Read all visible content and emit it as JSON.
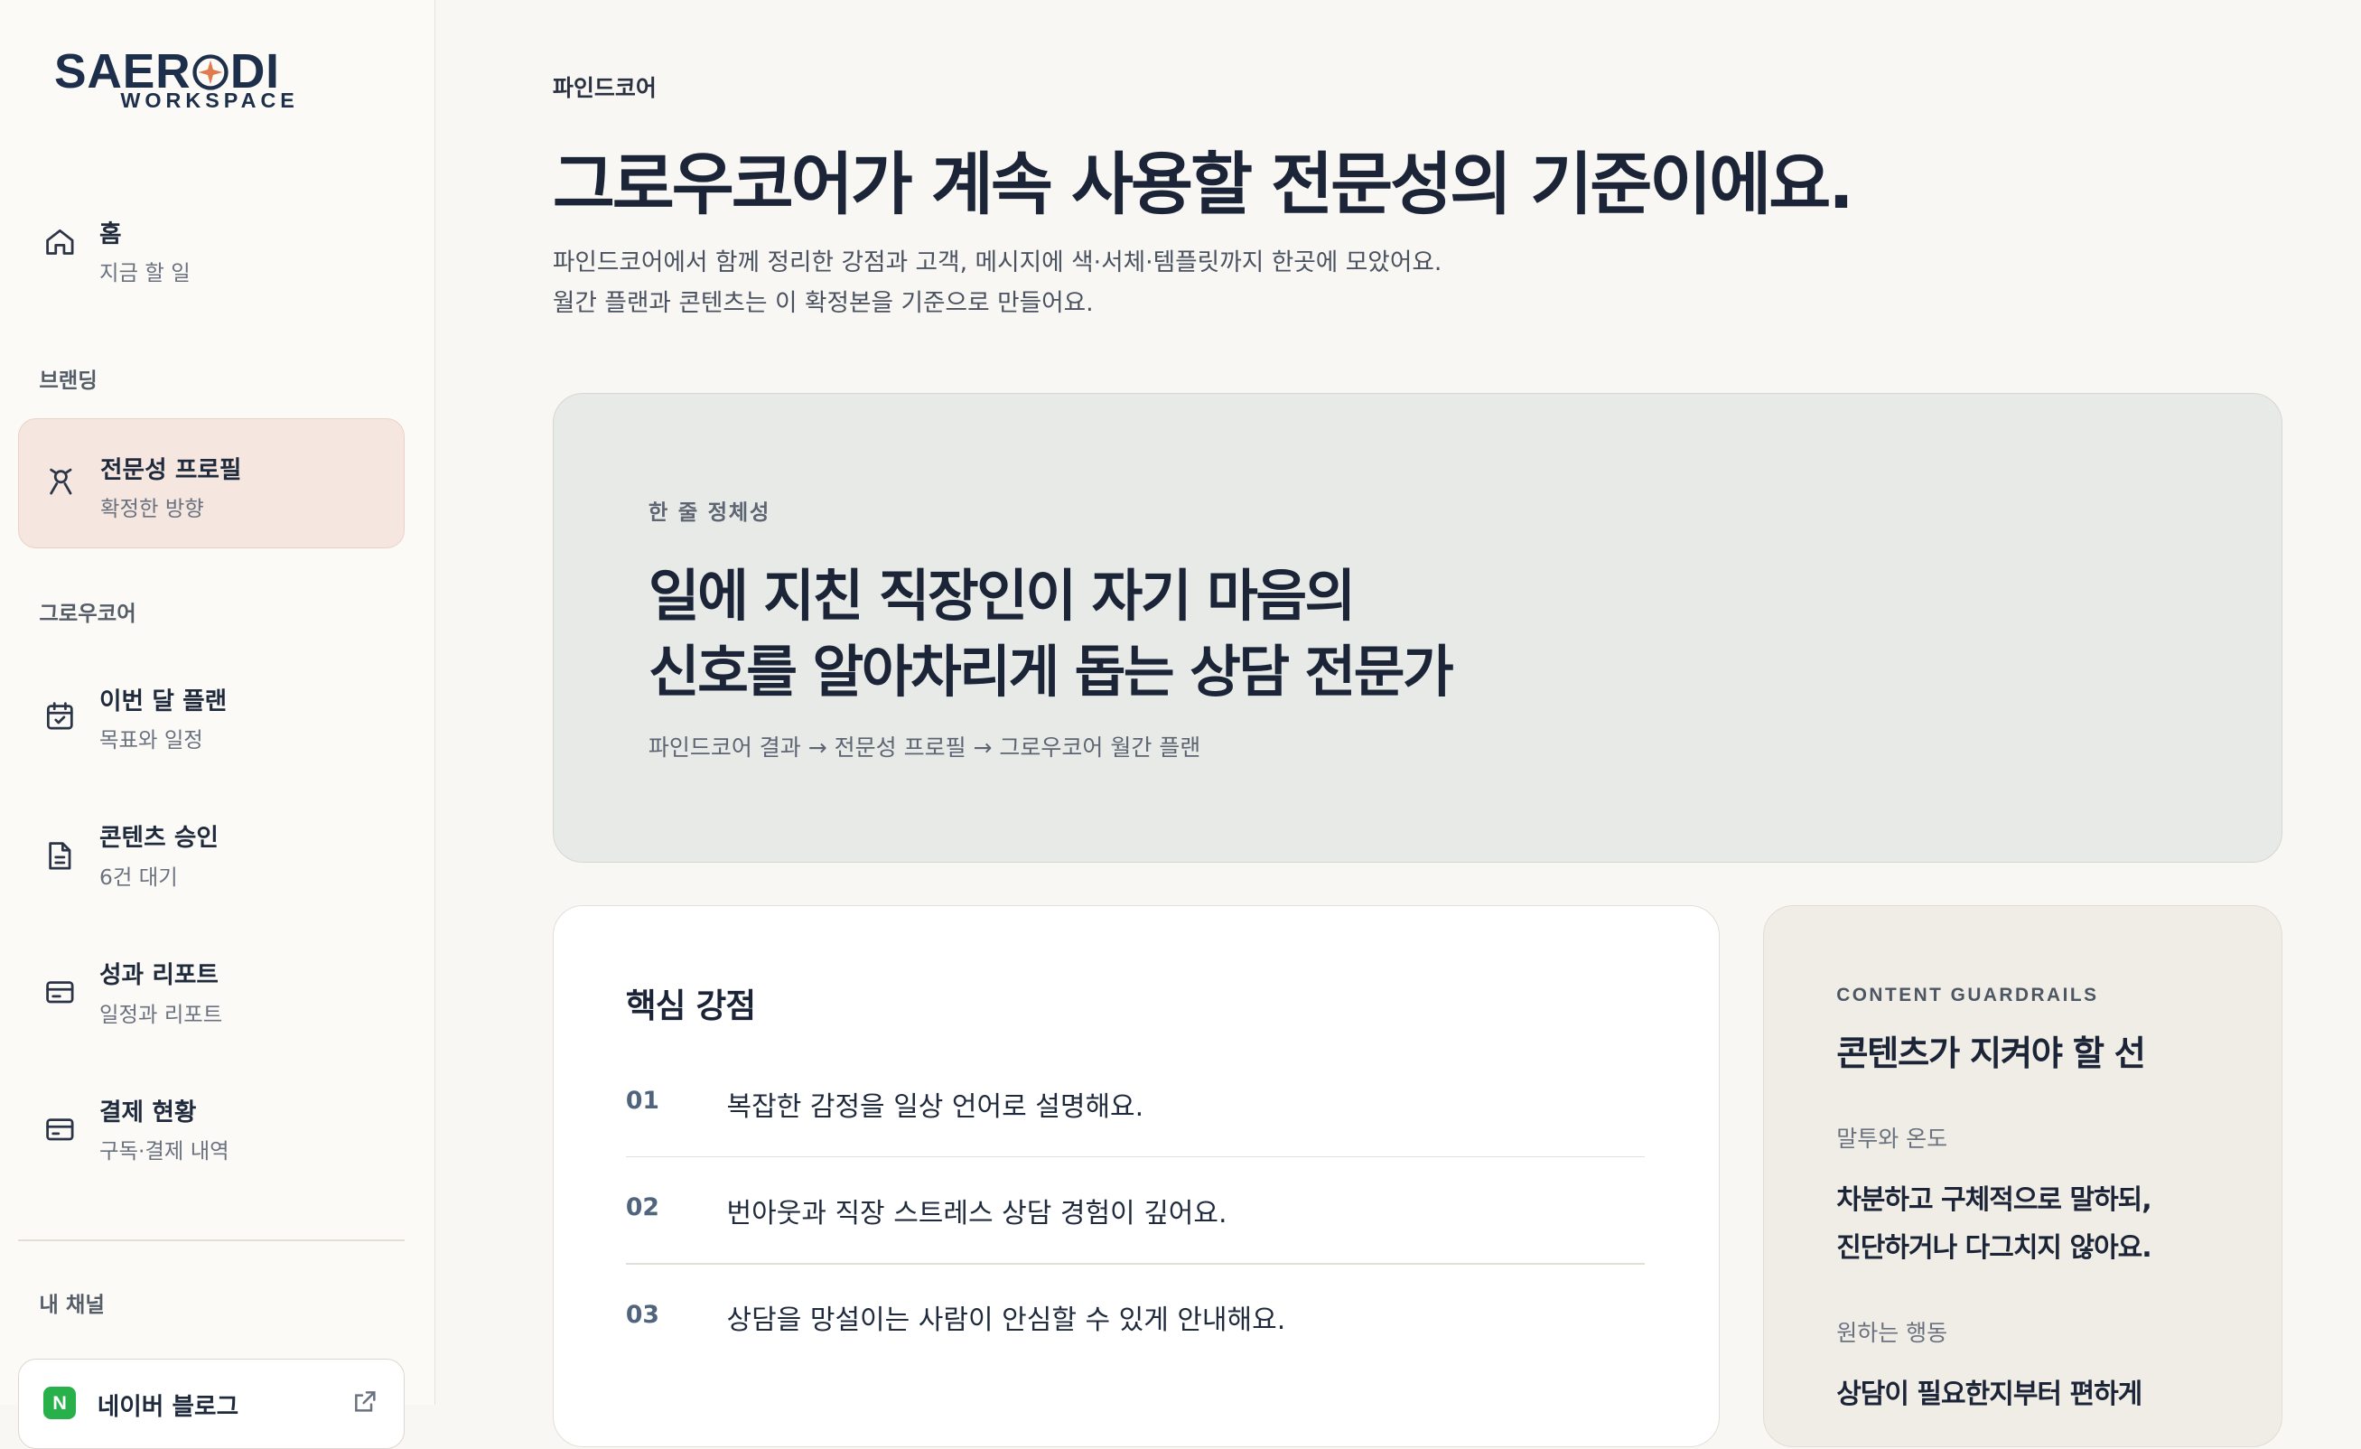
{
  "brand": {
    "name_left": "SAER",
    "name_right": "DI",
    "sub": "WORKSPACE",
    "accent": "#e07a50"
  },
  "sidebar": {
    "home": {
      "title": "홈",
      "sub": "지금 할 일",
      "icon": "home-icon"
    },
    "section_branding": "브랜딩",
    "profile": {
      "title": "전문성 프로필",
      "sub": "확정한 방향",
      "icon": "person-icon"
    },
    "section_growcore": "그로우코어",
    "items": [
      {
        "title": "이번 달 플랜",
        "sub": "목표와 일정",
        "icon": "calendar-check-icon"
      },
      {
        "title": "콘텐츠 승인",
        "sub": "6건 대기",
        "icon": "document-icon"
      },
      {
        "title": "성과 리포트",
        "sub": "일정과 리포트",
        "icon": "report-card-icon"
      },
      {
        "title": "결제 현황",
        "sub": "구독·결제 내역",
        "icon": "credit-card-icon"
      }
    ],
    "section_channels": "내 채널",
    "channel": {
      "badge": "N",
      "title": "네이버 블로그",
      "icon": "external-link-icon"
    }
  },
  "main": {
    "eyebrow": "파인드코어",
    "headline": "그로우코어가 계속 사용할 전문성의 기준이에요.",
    "desc_line1": "파인드코어에서 함께 정리한 강점과 고객, 메시지에 색·서체·템플릿까지 한곳에 모았어요.",
    "desc_line2": "월간 플랜과 콘텐츠는 이 확정본을 기준으로 만들어요.",
    "hero": {
      "label": "한 줄 정체성",
      "line1": "일에 지친 직장인이 자기 마음의",
      "line2": "신호를 알아차리게 돕는 상담 전문가",
      "path": "파인드코어 결과 → 전문성 프로필 → 그로우코어 월간 플랜"
    },
    "strengths": {
      "title": "핵심 강점",
      "items": [
        {
          "num": "01",
          "text": "복잡한 감정을 일상 언어로 설명해요."
        },
        {
          "num": "02",
          "text": "번아웃과 직장 스트레스 상담 경험이 깊어요."
        },
        {
          "num": "03",
          "text": "상담을 망설이는 사람이 안심할 수 있게 안내해요."
        }
      ]
    },
    "guardrails": {
      "eyebrow": "CONTENT GUARDRAILS",
      "title": "콘텐츠가 지켜야 할 선",
      "tone_label": "말투와 온도",
      "tone_line1": "차분하고 구체적으로 말하되,",
      "tone_line2": "진단하거나 다그치지 않아요.",
      "action_label": "원하는 행동",
      "action_line1": "상담이 필요한지부터 편하게"
    }
  }
}
